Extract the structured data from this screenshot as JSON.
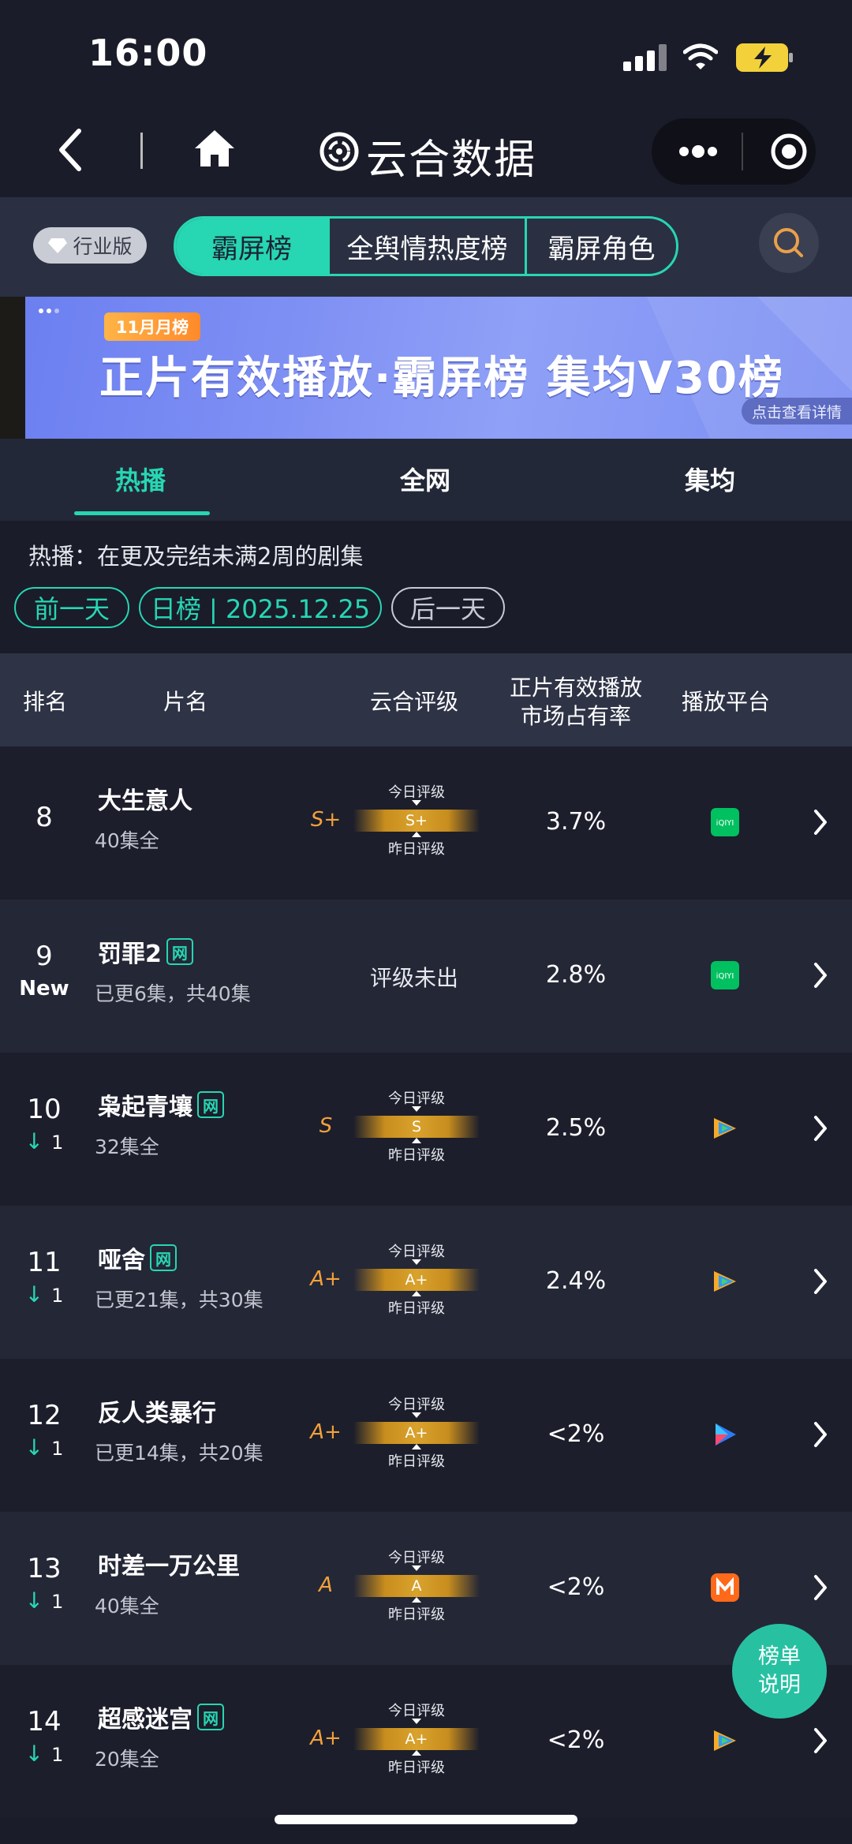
{
  "status_bar": {
    "time": "16:00"
  },
  "nav": {
    "title": "云合数据"
  },
  "top_tabs": {
    "edition": "行业版",
    "segments": [
      "霸屏榜",
      "全舆情热度榜",
      "霸屏角色"
    ]
  },
  "banner": {
    "badge": "11月月榜",
    "title": "正片有效播放·霸屏榜 集均V30榜",
    "link": "点击查看详情"
  },
  "sub_tabs": [
    "热播",
    "全网",
    "集均"
  ],
  "description": "热播：在更及完结未满2周的剧集",
  "date_nav": {
    "prev": "前一天",
    "current": "日榜 | 2025.12.25",
    "next": "后一天"
  },
  "table_header": {
    "rank": "排名",
    "name": "片名",
    "rating": "云合评级",
    "share_line1": "正片有效播放",
    "share_line2": "市场占有率",
    "platform": "播放平台"
  },
  "grade_labels": {
    "today": "今日评级",
    "yesterday": "昨日评级"
  },
  "rows": [
    {
      "rank": "8",
      "title": "大生意人",
      "net": "",
      "sub": "40集全",
      "grade": "S+",
      "bar": "S+",
      "share": "3.7%",
      "platform": "iqiyi"
    },
    {
      "rank": "9",
      "new": "New",
      "title": "罚罪2",
      "net": "网",
      "sub": "已更6集，共40集",
      "grade": "",
      "no_grade": "评级未出",
      "share": "2.8%",
      "platform": "iqiyi"
    },
    {
      "rank": "10",
      "change": "1",
      "title": "枭起青壤",
      "net": "网",
      "sub": "32集全",
      "grade": "S",
      "bar": "S",
      "share": "2.5%",
      "platform": "tencent"
    },
    {
      "rank": "11",
      "change": "1",
      "title": "哑舍",
      "net": "网",
      "sub": "已更21集，共30集",
      "grade": "A+",
      "bar": "A+",
      "share": "2.4%",
      "platform": "tencent"
    },
    {
      "rank": "12",
      "change": "1",
      "title": "反人类暴行",
      "net": "",
      "sub": "已更14集，共20集",
      "grade": "A+",
      "bar": "A+",
      "share": "<2%",
      "platform": "youku"
    },
    {
      "rank": "13",
      "change": "1",
      "title": "时差一万公里",
      "net": "",
      "sub": "40集全",
      "grade": "A",
      "bar": "A",
      "share": "<2%",
      "platform": "mango"
    },
    {
      "rank": "14",
      "change": "1",
      "title": "超感迷宫",
      "net": "网",
      "sub": "20集全",
      "grade": "A+",
      "bar": "A+",
      "share": "<2%",
      "platform": "tencent"
    }
  ],
  "fab": {
    "line1": "榜单",
    "line2": "说明"
  },
  "colors": {
    "accent": "#27d6b3",
    "grade": "#f3a13a",
    "background": "#1a1c2a"
  }
}
